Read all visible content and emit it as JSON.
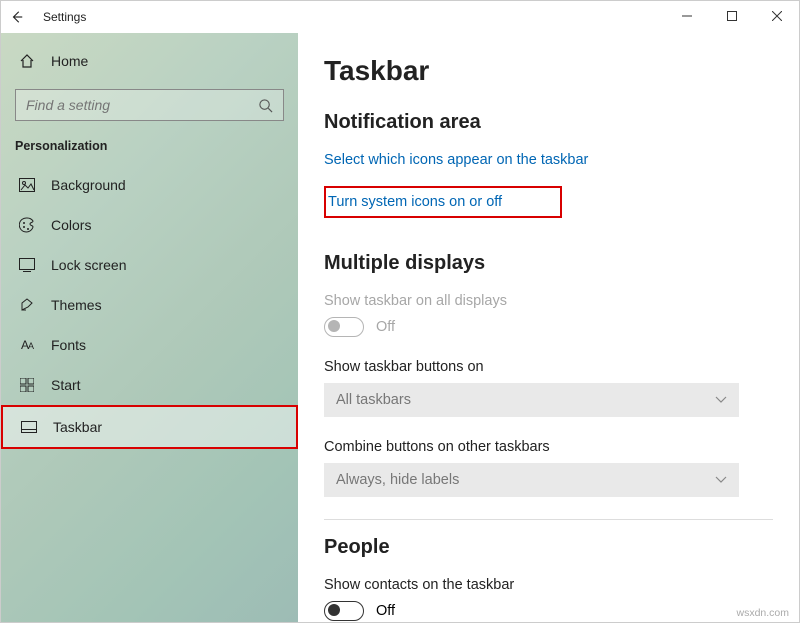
{
  "window": {
    "title": "Settings"
  },
  "sidebar": {
    "home": "Home",
    "search_placeholder": "Find a setting",
    "category": "Personalization",
    "items": [
      {
        "label": "Background"
      },
      {
        "label": "Colors"
      },
      {
        "label": "Lock screen"
      },
      {
        "label": "Themes"
      },
      {
        "label": "Fonts"
      },
      {
        "label": "Start"
      },
      {
        "label": "Taskbar"
      }
    ]
  },
  "main": {
    "title": "Taskbar",
    "notification": {
      "heading": "Notification area",
      "link1": "Select which icons appear on the taskbar",
      "link2": "Turn system icons on or off"
    },
    "multiple": {
      "heading": "Multiple displays",
      "show_all_label": "Show taskbar on all displays",
      "show_all_state": "Off",
      "buttons_label": "Show taskbar buttons on",
      "buttons_value": "All taskbars",
      "combine_label": "Combine buttons on other taskbars",
      "combine_value": "Always, hide labels"
    },
    "people": {
      "heading": "People",
      "contacts_label": "Show contacts on the taskbar",
      "contacts_state": "Off"
    }
  },
  "watermark": "wsxdn.com"
}
